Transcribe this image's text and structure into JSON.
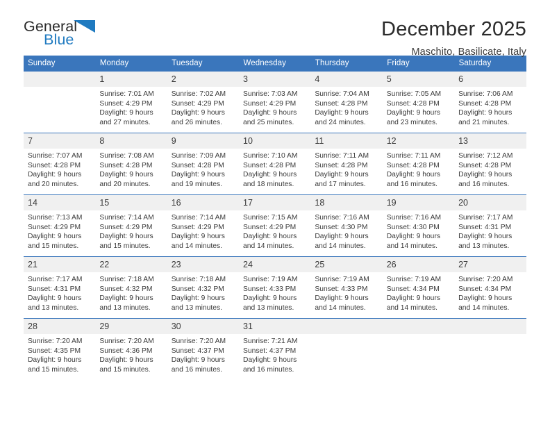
{
  "brand": {
    "name_part1": "General",
    "name_part2": "Blue"
  },
  "header": {
    "title": "December 2025",
    "subtitle": "Maschito, Basilicate, Italy"
  },
  "calendar": {
    "weekday_headers": [
      "Sunday",
      "Monday",
      "Tuesday",
      "Wednesday",
      "Thursday",
      "Friday",
      "Saturday"
    ],
    "accent_color": "#3a76bc",
    "daynum_bg": "#f0f0f0",
    "weeks": [
      [
        {
          "day": "",
          "sunrise": "",
          "sunset": "",
          "daylight_line1": "",
          "daylight_line2": ""
        },
        {
          "day": "1",
          "sunrise": "Sunrise: 7:01 AM",
          "sunset": "Sunset: 4:29 PM",
          "daylight_line1": "Daylight: 9 hours",
          "daylight_line2": "and 27 minutes."
        },
        {
          "day": "2",
          "sunrise": "Sunrise: 7:02 AM",
          "sunset": "Sunset: 4:29 PM",
          "daylight_line1": "Daylight: 9 hours",
          "daylight_line2": "and 26 minutes."
        },
        {
          "day": "3",
          "sunrise": "Sunrise: 7:03 AM",
          "sunset": "Sunset: 4:29 PM",
          "daylight_line1": "Daylight: 9 hours",
          "daylight_line2": "and 25 minutes."
        },
        {
          "day": "4",
          "sunrise": "Sunrise: 7:04 AM",
          "sunset": "Sunset: 4:28 PM",
          "daylight_line1": "Daylight: 9 hours",
          "daylight_line2": "and 24 minutes."
        },
        {
          "day": "5",
          "sunrise": "Sunrise: 7:05 AM",
          "sunset": "Sunset: 4:28 PM",
          "daylight_line1": "Daylight: 9 hours",
          "daylight_line2": "and 23 minutes."
        },
        {
          "day": "6",
          "sunrise": "Sunrise: 7:06 AM",
          "sunset": "Sunset: 4:28 PM",
          "daylight_line1": "Daylight: 9 hours",
          "daylight_line2": "and 21 minutes."
        }
      ],
      [
        {
          "day": "7",
          "sunrise": "Sunrise: 7:07 AM",
          "sunset": "Sunset: 4:28 PM",
          "daylight_line1": "Daylight: 9 hours",
          "daylight_line2": "and 20 minutes."
        },
        {
          "day": "8",
          "sunrise": "Sunrise: 7:08 AM",
          "sunset": "Sunset: 4:28 PM",
          "daylight_line1": "Daylight: 9 hours",
          "daylight_line2": "and 20 minutes."
        },
        {
          "day": "9",
          "sunrise": "Sunrise: 7:09 AM",
          "sunset": "Sunset: 4:28 PM",
          "daylight_line1": "Daylight: 9 hours",
          "daylight_line2": "and 19 minutes."
        },
        {
          "day": "10",
          "sunrise": "Sunrise: 7:10 AM",
          "sunset": "Sunset: 4:28 PM",
          "daylight_line1": "Daylight: 9 hours",
          "daylight_line2": "and 18 minutes."
        },
        {
          "day": "11",
          "sunrise": "Sunrise: 7:11 AM",
          "sunset": "Sunset: 4:28 PM",
          "daylight_line1": "Daylight: 9 hours",
          "daylight_line2": "and 17 minutes."
        },
        {
          "day": "12",
          "sunrise": "Sunrise: 7:11 AM",
          "sunset": "Sunset: 4:28 PM",
          "daylight_line1": "Daylight: 9 hours",
          "daylight_line2": "and 16 minutes."
        },
        {
          "day": "13",
          "sunrise": "Sunrise: 7:12 AM",
          "sunset": "Sunset: 4:28 PM",
          "daylight_line1": "Daylight: 9 hours",
          "daylight_line2": "and 16 minutes."
        }
      ],
      [
        {
          "day": "14",
          "sunrise": "Sunrise: 7:13 AM",
          "sunset": "Sunset: 4:29 PM",
          "daylight_line1": "Daylight: 9 hours",
          "daylight_line2": "and 15 minutes."
        },
        {
          "day": "15",
          "sunrise": "Sunrise: 7:14 AM",
          "sunset": "Sunset: 4:29 PM",
          "daylight_line1": "Daylight: 9 hours",
          "daylight_line2": "and 15 minutes."
        },
        {
          "day": "16",
          "sunrise": "Sunrise: 7:14 AM",
          "sunset": "Sunset: 4:29 PM",
          "daylight_line1": "Daylight: 9 hours",
          "daylight_line2": "and 14 minutes."
        },
        {
          "day": "17",
          "sunrise": "Sunrise: 7:15 AM",
          "sunset": "Sunset: 4:29 PM",
          "daylight_line1": "Daylight: 9 hours",
          "daylight_line2": "and 14 minutes."
        },
        {
          "day": "18",
          "sunrise": "Sunrise: 7:16 AM",
          "sunset": "Sunset: 4:30 PM",
          "daylight_line1": "Daylight: 9 hours",
          "daylight_line2": "and 14 minutes."
        },
        {
          "day": "19",
          "sunrise": "Sunrise: 7:16 AM",
          "sunset": "Sunset: 4:30 PM",
          "daylight_line1": "Daylight: 9 hours",
          "daylight_line2": "and 14 minutes."
        },
        {
          "day": "20",
          "sunrise": "Sunrise: 7:17 AM",
          "sunset": "Sunset: 4:31 PM",
          "daylight_line1": "Daylight: 9 hours",
          "daylight_line2": "and 13 minutes."
        }
      ],
      [
        {
          "day": "21",
          "sunrise": "Sunrise: 7:17 AM",
          "sunset": "Sunset: 4:31 PM",
          "daylight_line1": "Daylight: 9 hours",
          "daylight_line2": "and 13 minutes."
        },
        {
          "day": "22",
          "sunrise": "Sunrise: 7:18 AM",
          "sunset": "Sunset: 4:32 PM",
          "daylight_line1": "Daylight: 9 hours",
          "daylight_line2": "and 13 minutes."
        },
        {
          "day": "23",
          "sunrise": "Sunrise: 7:18 AM",
          "sunset": "Sunset: 4:32 PM",
          "daylight_line1": "Daylight: 9 hours",
          "daylight_line2": "and 13 minutes."
        },
        {
          "day": "24",
          "sunrise": "Sunrise: 7:19 AM",
          "sunset": "Sunset: 4:33 PM",
          "daylight_line1": "Daylight: 9 hours",
          "daylight_line2": "and 13 minutes."
        },
        {
          "day": "25",
          "sunrise": "Sunrise: 7:19 AM",
          "sunset": "Sunset: 4:33 PM",
          "daylight_line1": "Daylight: 9 hours",
          "daylight_line2": "and 14 minutes."
        },
        {
          "day": "26",
          "sunrise": "Sunrise: 7:19 AM",
          "sunset": "Sunset: 4:34 PM",
          "daylight_line1": "Daylight: 9 hours",
          "daylight_line2": "and 14 minutes."
        },
        {
          "day": "27",
          "sunrise": "Sunrise: 7:20 AM",
          "sunset": "Sunset: 4:34 PM",
          "daylight_line1": "Daylight: 9 hours",
          "daylight_line2": "and 14 minutes."
        }
      ],
      [
        {
          "day": "28",
          "sunrise": "Sunrise: 7:20 AM",
          "sunset": "Sunset: 4:35 PM",
          "daylight_line1": "Daylight: 9 hours",
          "daylight_line2": "and 15 minutes."
        },
        {
          "day": "29",
          "sunrise": "Sunrise: 7:20 AM",
          "sunset": "Sunset: 4:36 PM",
          "daylight_line1": "Daylight: 9 hours",
          "daylight_line2": "and 15 minutes."
        },
        {
          "day": "30",
          "sunrise": "Sunrise: 7:20 AM",
          "sunset": "Sunset: 4:37 PM",
          "daylight_line1": "Daylight: 9 hours",
          "daylight_line2": "and 16 minutes."
        },
        {
          "day": "31",
          "sunrise": "Sunrise: 7:21 AM",
          "sunset": "Sunset: 4:37 PM",
          "daylight_line1": "Daylight: 9 hours",
          "daylight_line2": "and 16 minutes."
        },
        {
          "day": "",
          "sunrise": "",
          "sunset": "",
          "daylight_line1": "",
          "daylight_line2": ""
        },
        {
          "day": "",
          "sunrise": "",
          "sunset": "",
          "daylight_line1": "",
          "daylight_line2": ""
        },
        {
          "day": "",
          "sunrise": "",
          "sunset": "",
          "daylight_line1": "",
          "daylight_line2": ""
        }
      ]
    ]
  }
}
